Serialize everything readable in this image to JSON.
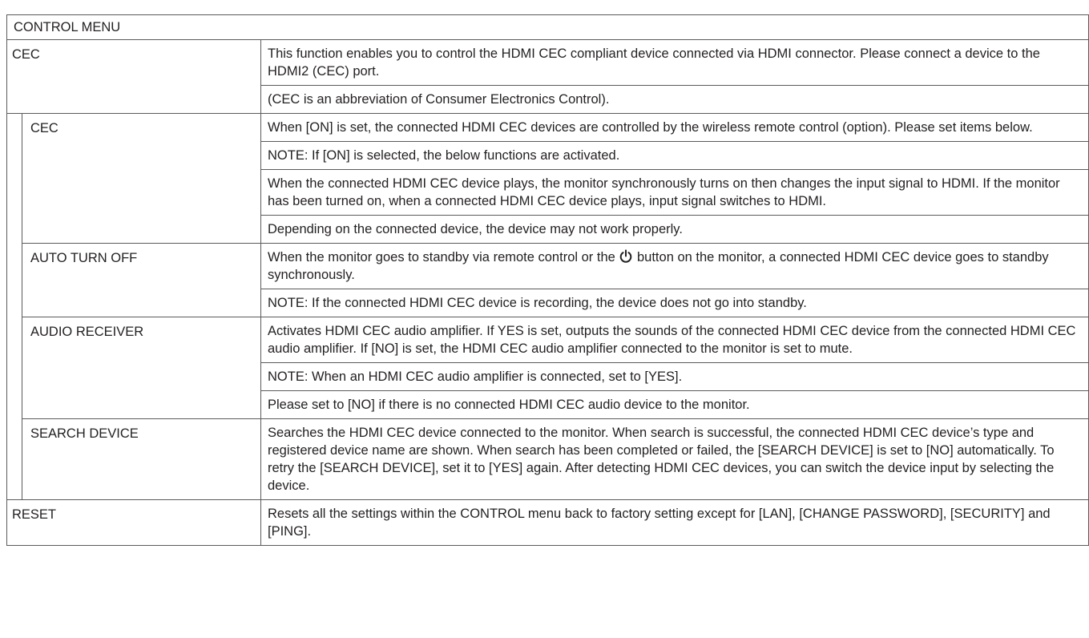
{
  "header": "CONTROL MENU",
  "cec_group": {
    "label": "CEC",
    "desc": [
      "This function enables you to control the HDMI CEC compliant device connected via HDMI connector. Please connect a device to the HDMI2 (CEC) port.",
      "(CEC is an abbreviation of Consumer Electronics Control)."
    ]
  },
  "cec": {
    "label": "CEC",
    "desc": [
      "When [ON] is set, the connected HDMI CEC devices are controlled by the wireless remote control (option). Please set items below.",
      "NOTE: If [ON] is selected, the below functions are activated.",
      "When the connected HDMI CEC device plays, the monitor synchronously turns on then changes the input signal to HDMI. If the monitor has been turned on, when a connected HDMI CEC device plays, input signal switches to HDMI.",
      "Depending on the connected device, the device may not work properly."
    ]
  },
  "auto_turn_off": {
    "label": "AUTO TURN OFF",
    "desc_before_icon": "When the monitor goes to standby via remote control or the ",
    "desc_after_icon": " button on the monitor, a connected HDMI CEC device goes to standby synchronously.",
    "icon": "power-icon",
    "note": "NOTE: If the connected HDMI CEC device is recording, the device does not go into standby."
  },
  "audio_receiver": {
    "label": "AUDIO RECEIVER",
    "desc": [
      "Activates HDMI CEC audio amplifier. If YES is set, outputs the sounds of the connected HDMI CEC device from the connected HDMI CEC audio amplifier. If [NO] is set, the HDMI CEC audio amplifier connected to the monitor is set to mute.",
      "NOTE: When an HDMI CEC audio amplifier is connected, set to [YES].",
      "Please set to [NO] if there is no connected HDMI CEC audio device to the monitor."
    ]
  },
  "search_device": {
    "label": "SEARCH DEVICE",
    "desc": [
      "Searches the HDMI CEC device connected to the monitor. When search is successful, the connected HDMI CEC device’s type and registered device name are shown. When search has been completed or failed, the [SEARCH DEVICE] is set to [NO] automatically. To retry the [SEARCH DEVICE], set it to [YES] again. After detecting HDMI CEC devices, you can switch the device input by selecting the device."
    ]
  },
  "reset": {
    "label": "RESET",
    "desc": [
      "Resets all the settings within the CONTROL menu back to factory setting except for [LAN], [CHANGE PASSWORD], [SECURITY] and [PING]."
    ]
  }
}
